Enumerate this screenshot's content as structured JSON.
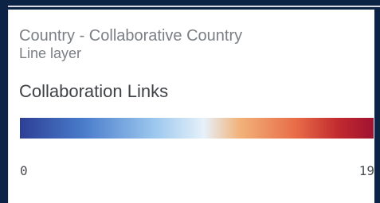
{
  "legend": {
    "layer_name": "Country - Collaborative Country",
    "layer_type": "Line layer",
    "title": "Collaboration Links",
    "scale": {
      "min": "0",
      "max": "19",
      "colors": [
        "#2d3f95",
        "#4a7ccb",
        "#9cc7ee",
        "#e6f1fa",
        "#f2b37b",
        "#e86c47",
        "#c12a2f",
        "#a01231"
      ]
    }
  }
}
